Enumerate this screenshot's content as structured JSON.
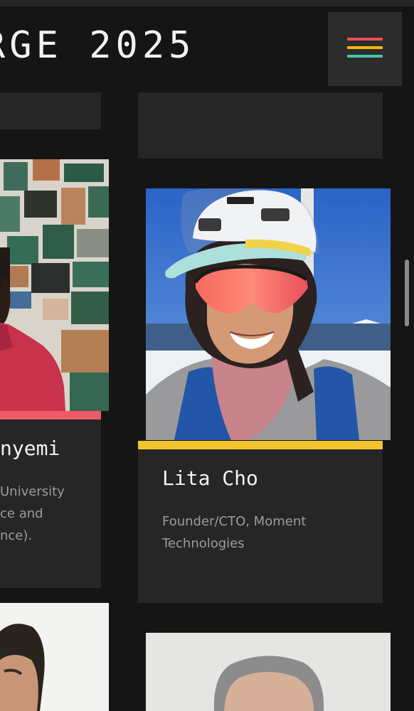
{
  "header": {
    "title": "RGE 2025",
    "menu_icon": "hamburger-menu-icon",
    "menu_colors": [
      "#ef4f57",
      "#f5b700",
      "#49c2a8"
    ]
  },
  "people": [
    {
      "name": "nyemi",
      "role_lines": [
        "University",
        "ce and",
        "nce)."
      ],
      "accent_color": "#ef5a6a",
      "photo": "portrait-circuit-boards"
    },
    {
      "name": "Lita Cho",
      "role_lines": [
        "Founder/CTO, Moment",
        "Technologies"
      ],
      "accent_color": "#f4c430",
      "photo": "portrait-climber-helmet"
    },
    {
      "name": "",
      "role_lines": [],
      "photo": "portrait-dark-hair"
    },
    {
      "name": "",
      "role_lines": [],
      "photo": "portrait-gray-hair"
    }
  ]
}
